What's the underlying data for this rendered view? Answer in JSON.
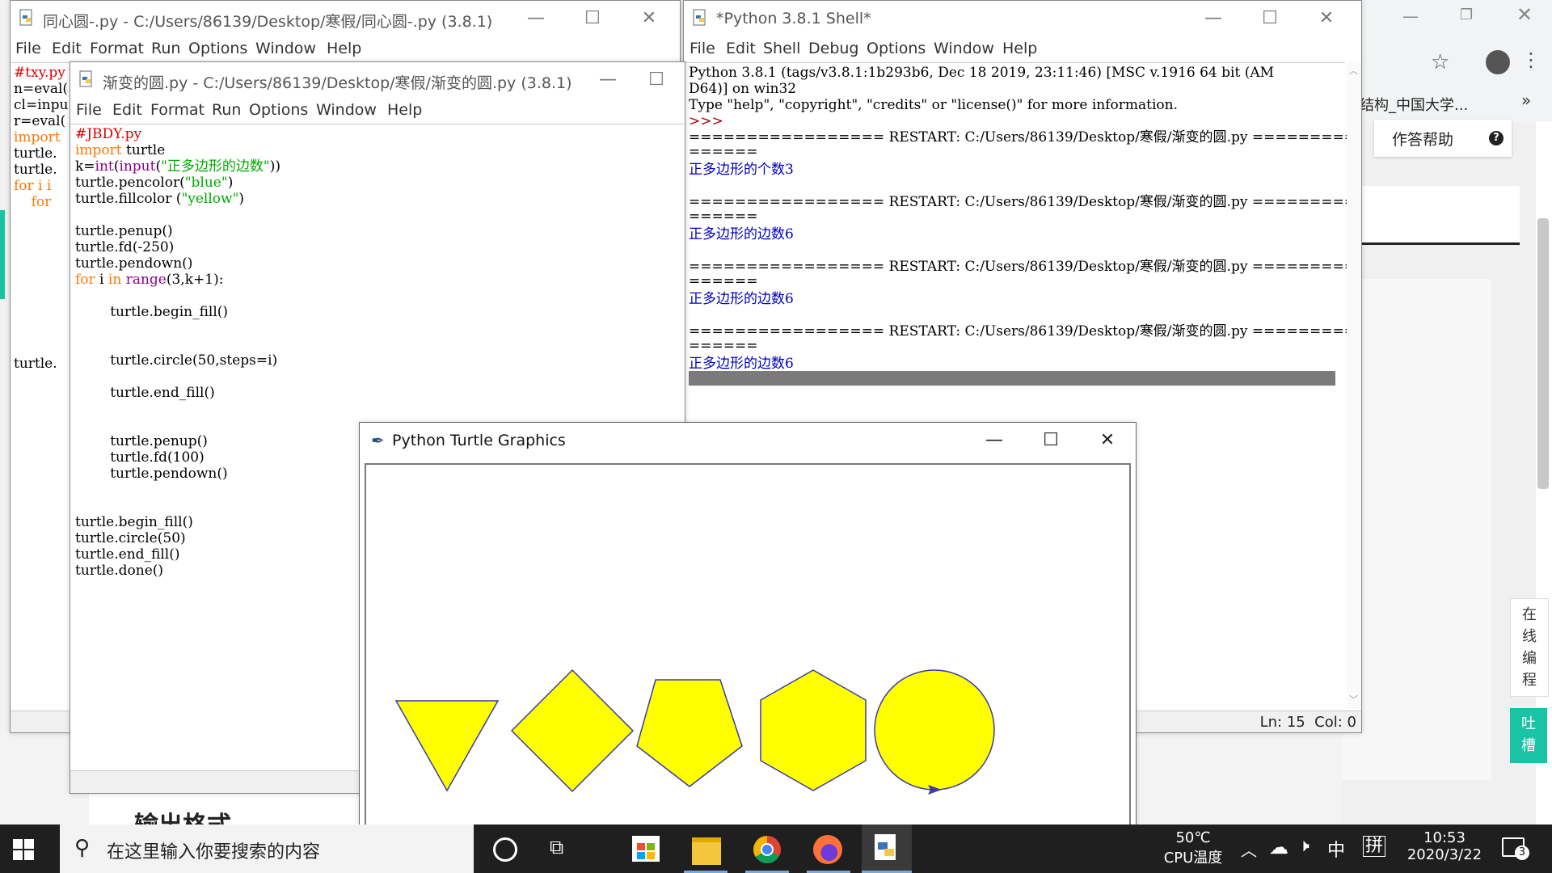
{
  "browser": {
    "tab_text": "结构_中国大学...",
    "chevron": "»",
    "help_button": "作答帮助",
    "help_icon": "❓",
    "side_tab": [
      "在",
      "线",
      "编",
      "程"
    ],
    "side_tab2": [
      "吐",
      "槽"
    ],
    "bottom_heading": "输出格式"
  },
  "win_concentric": {
    "title": "同心圆-.py - C:/Users/86139/Desktop/寒假/同心圆-.py (3.8.1)",
    "menu": [
      "File",
      "Edit",
      "Format",
      "Run",
      "Options",
      "Window",
      "Help"
    ],
    "code_lines": [
      "#txy.py",
      "n=eval(",
      "cl=inpu",
      "r=eval(",
      "import ",
      "turtle.",
      "turtle.",
      "for i i",
      "    for",
      "",
      "",
      "",
      "",
      "",
      "",
      "",
      "",
      "",
      "turtle."
    ]
  },
  "win_gradient": {
    "title": "渐变的圆.py - C:/Users/86139/Desktop/寒假/渐变的圆.py (3.8.1)",
    "menu": [
      "File",
      "Edit",
      "Format",
      "Run",
      "Options",
      "Window",
      "Help"
    ],
    "code": {
      "l1": "#JBDY.py",
      "l2_kw": "import",
      "l2_rest": " turtle",
      "l3_a": "k=",
      "l3_b": "int",
      "l3_c": "(",
      "l3_d": "input",
      "l3_e": "(",
      "l3_f": "\"正多边形的边数\"",
      "l3_g": "))",
      "l4_a": "turtle.pencolor(",
      "l4_b": "\"blue\"",
      "l4_c": ")",
      "l5_a": "turtle.fillcolor (",
      "l5_b": "\"yellow\"",
      "l5_c": ")",
      "l7": "turtle.penup()",
      "l8": "turtle.fd(-250)",
      "l9": "turtle.pendown()",
      "l10_a": "for",
      "l10_b": " i ",
      "l10_c": "in",
      "l10_d": " ",
      "l10_e": "range",
      "l10_f": "(3,k+1):",
      "l12": "        turtle.begin_fill()",
      "l15": "        turtle.circle(50,steps=i)",
      "l17": "        turtle.end_fill()",
      "l20": "        turtle.penup()",
      "l21": "        turtle.fd(100)",
      "l22": "        turtle.pendown()",
      "l25": "turtle.begin_fill()",
      "l26": "turtle.circle(50)",
      "l27": "turtle.end_fill()",
      "l28": "turtle.done()"
    }
  },
  "win_shell": {
    "title": "*Python 3.8.1 Shell*",
    "menu": [
      "File",
      "Edit",
      "Shell",
      "Debug",
      "Options",
      "Window",
      "Help"
    ],
    "banner1": "Python 3.8.1 (tags/v3.8.1:1b293b6, Dec 18 2019, 23:11:46) [MSC v.1916 64 bit (AM",
    "banner2": "D64)] on win32",
    "banner3": "Type \"help\", \"copyright\", \"credits\" or \"license()\" for more information.",
    "prompt": ">>>",
    "restart1": "================= RESTART: C:/Users/86139/Desktop/寒假/渐变的圆.py ===========",
    "restart2": "======",
    "out1": "正多边形的个数3",
    "out2": "正多边形的边数6",
    "out3": "正多边形的边数6",
    "out4": "正多边形的边数6",
    "status": "Ln: 15  Col: 0"
  },
  "win_turtle": {
    "title": "Python Turtle Graphics",
    "fill_color": "#ffff00",
    "pen_color": "#3a3aa8"
  },
  "taskbar": {
    "search_placeholder": "在这里输入你要搜索的内容",
    "temp": "50℃",
    "temp_label": "CPU温度",
    "ime1": "中",
    "ime2": "拼",
    "time": "10:53",
    "date": "2020/3/22",
    "notif_count": "3"
  }
}
